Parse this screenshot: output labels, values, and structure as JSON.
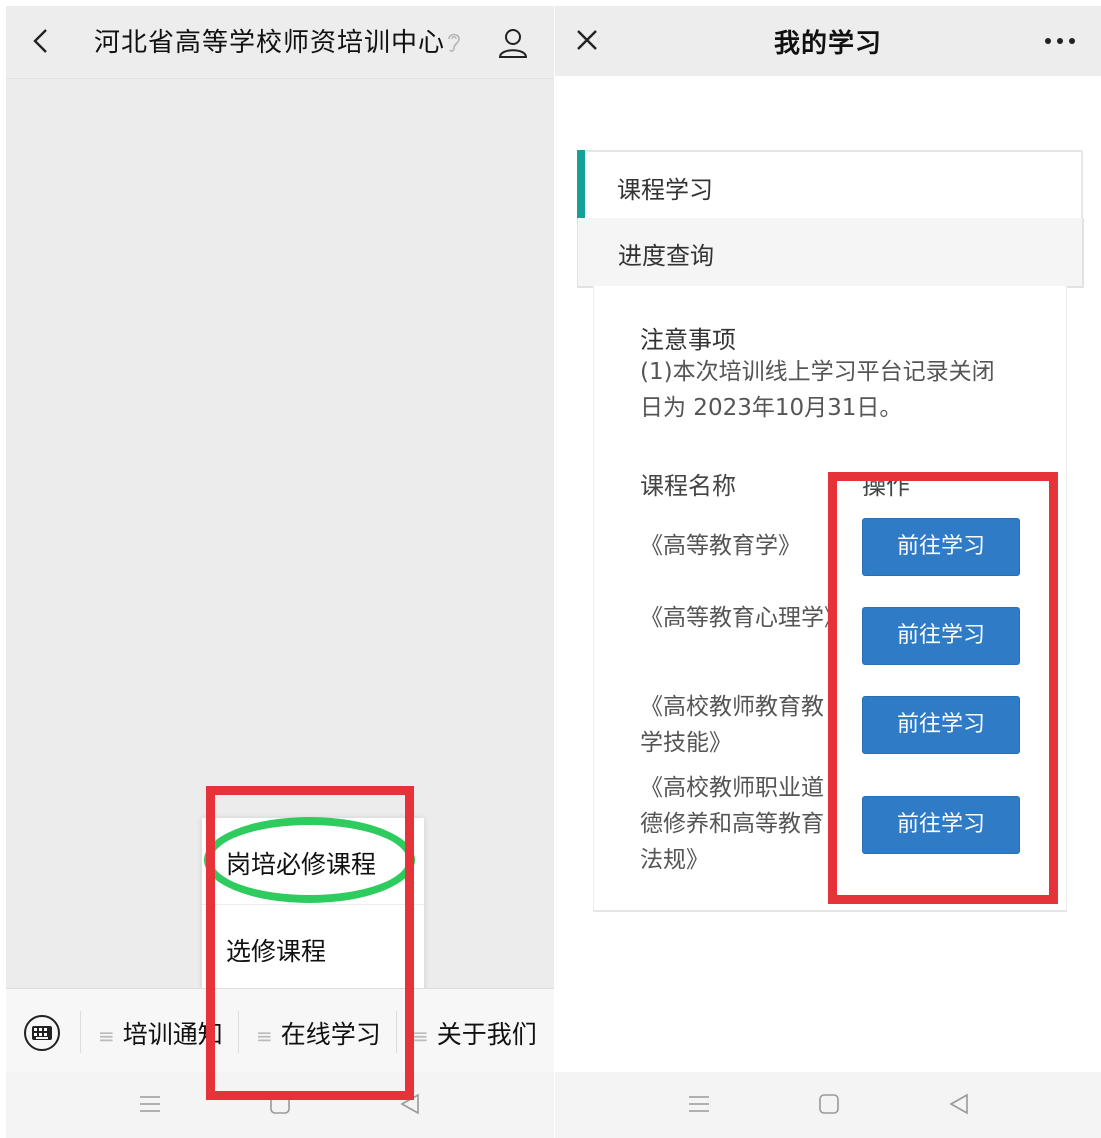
{
  "left": {
    "header": {
      "title": "河北省高等学校师资培训中心"
    },
    "popup": {
      "items": [
        "岗培必修课程",
        "选修课程"
      ]
    },
    "menubar": {
      "items": [
        "培训通知",
        "在线学习",
        "关于我们"
      ]
    }
  },
  "right": {
    "header": {
      "title": "我的学习"
    },
    "tabs": [
      "课程学习",
      "进度查询"
    ],
    "notice": {
      "title": "注意事项",
      "text": "(1)本次培训线上学习平台记录关闭日为 2023年10月31日。"
    },
    "table": {
      "col_name": "课程名称",
      "col_action": "操作",
      "rows": [
        {
          "name": "《高等教育学》",
          "button": "前往学习"
        },
        {
          "name": "《高等教育心理学》",
          "button": "前往学习"
        },
        {
          "name": "《高校教师教育教学技能》",
          "button": "前往学习"
        },
        {
          "name": "《高校教师职业道德修养和高等教育法规》",
          "button": "前往学习"
        }
      ]
    }
  },
  "colors": {
    "accent_teal": "#16a09a",
    "button_blue": "#2f7bc6",
    "highlight_red": "#e53339",
    "highlight_green": "#2ecc5e"
  }
}
